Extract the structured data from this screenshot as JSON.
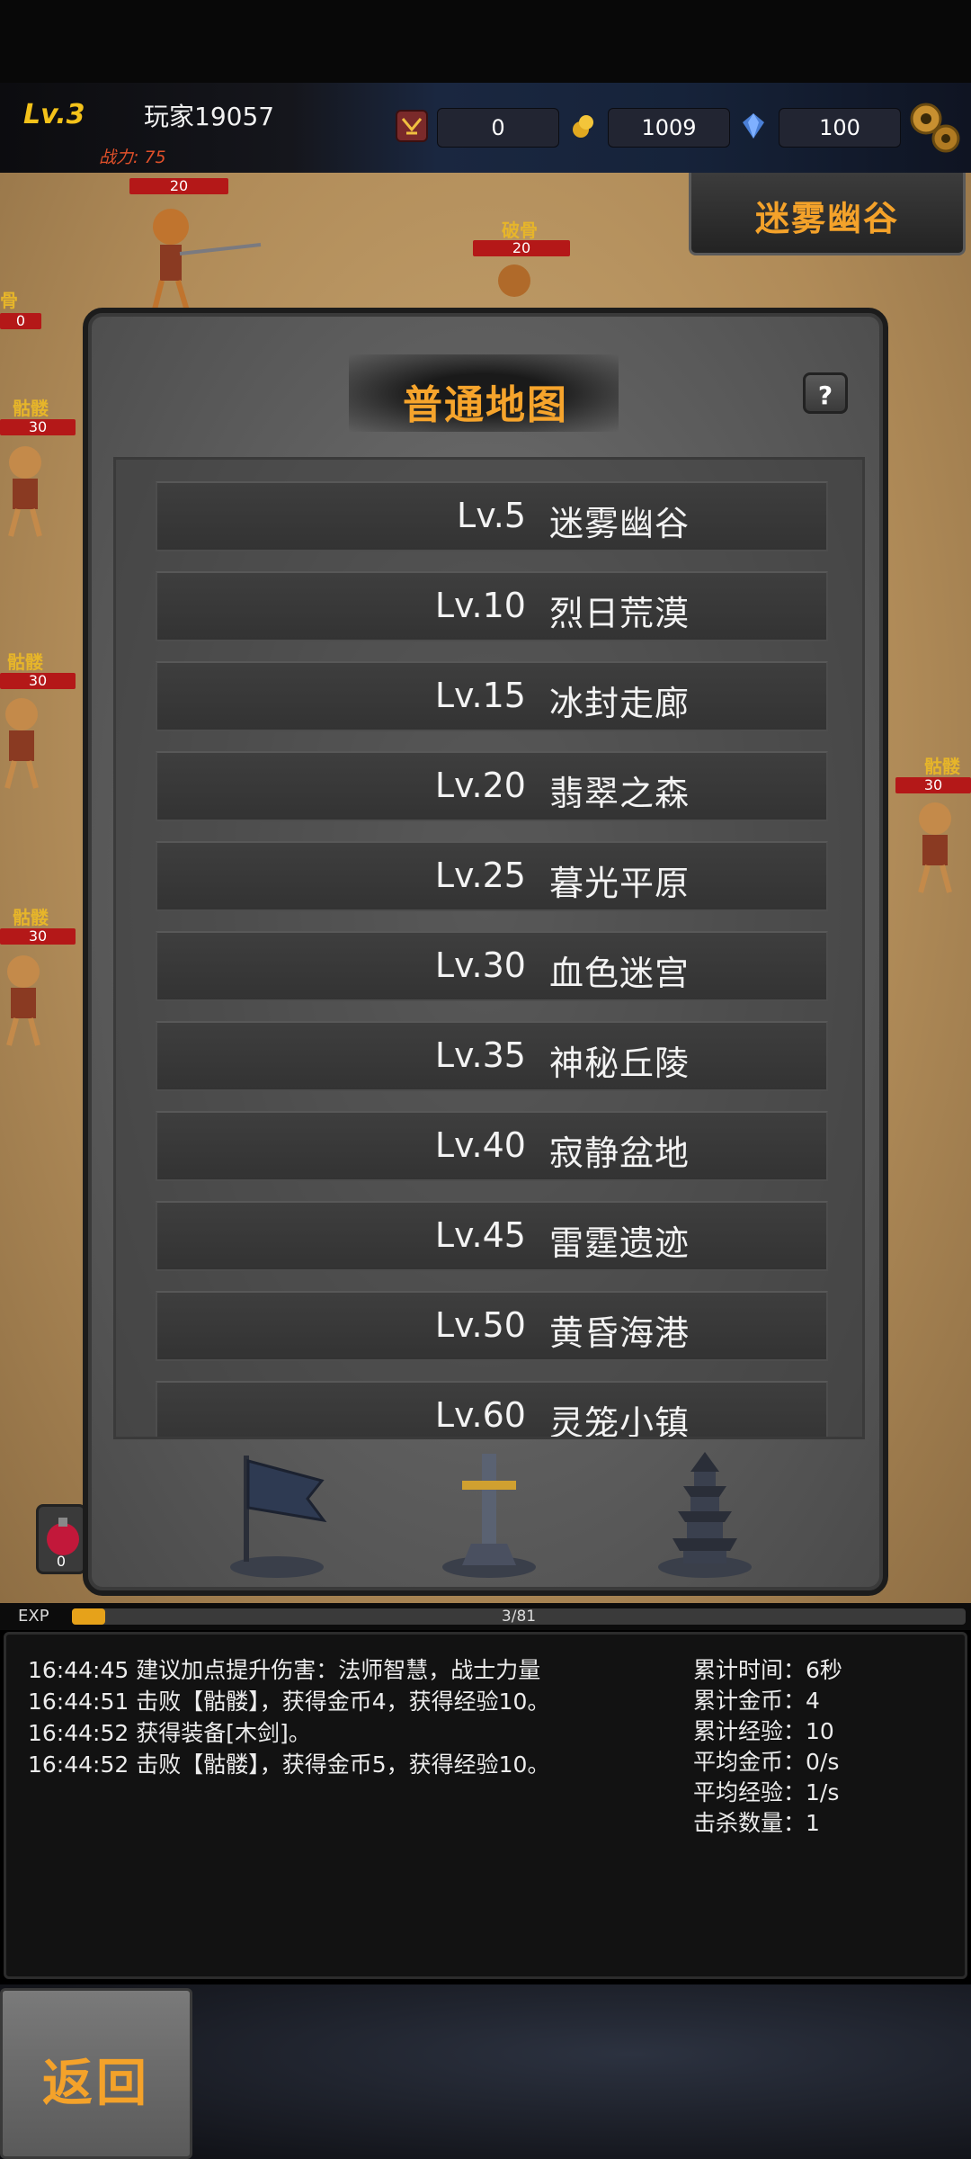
{
  "header": {
    "level": "Lv.3",
    "player_name": "玩家19057",
    "combat_power": "战力: 75",
    "resources": [
      {
        "icon": "sword-badge-icon",
        "value": "0"
      },
      {
        "icon": "gold-coin-icon",
        "value": "1009"
      },
      {
        "icon": "blue-gem-icon",
        "value": "100"
      }
    ],
    "settings_icon": "gear-icon"
  },
  "battlefield": {
    "current_map": "迷雾幽谷",
    "enemies": [
      {
        "name": "破骨",
        "hp": "20"
      },
      {
        "name": "",
        "hp": "20"
      },
      {
        "name": "骨",
        "hp": "0"
      },
      {
        "name": "骷髅",
        "hp": "30"
      },
      {
        "name": "骷髅",
        "hp": "30"
      },
      {
        "name": "骷髅",
        "hp": "30"
      },
      {
        "name": "骷髅",
        "hp": "30"
      }
    ],
    "potion_count": "0"
  },
  "dialog": {
    "title": "普通地图",
    "help_label": "?",
    "maps": [
      {
        "level": "Lv.5",
        "name": "迷雾幽谷"
      },
      {
        "level": "Lv.10",
        "name": "烈日荒漠"
      },
      {
        "level": "Lv.15",
        "name": "冰封走廊"
      },
      {
        "level": "Lv.20",
        "name": "翡翠之森"
      },
      {
        "level": "Lv.25",
        "name": "暮光平原"
      },
      {
        "level": "Lv.30",
        "name": "血色迷宫"
      },
      {
        "level": "Lv.35",
        "name": "神秘丘陵"
      },
      {
        "level": "Lv.40",
        "name": "寂静盆地"
      },
      {
        "level": "Lv.45",
        "name": "雷霆遗迹"
      },
      {
        "level": "Lv.50",
        "name": "黄昏海港"
      },
      {
        "level": "Lv.60",
        "name": "灵笼小镇"
      }
    ],
    "tabs": [
      {
        "icon": "battle-flag-icon"
      },
      {
        "icon": "sword-in-stone-icon"
      },
      {
        "icon": "pagoda-tower-icon"
      }
    ]
  },
  "exp": {
    "label": "EXP",
    "text": "3/81",
    "current": 3,
    "max": 81
  },
  "log": [
    "16:44:45 建议加点提升伤害：法师智慧，战士力量",
    "16:44:51 击败【骷髅】，获得金币4，获得经验10。",
    "16:44:52 获得装备[木剑]。",
    "16:44:52 击败【骷髅】，获得金币5，获得经验10。"
  ],
  "stats": [
    "累计时间：6秒",
    "累计金币：4",
    "累计经验：10",
    "平均金币：0/s",
    "平均经验：1/s",
    "击杀数量：1"
  ],
  "bottom": {
    "back_label": "返回"
  }
}
